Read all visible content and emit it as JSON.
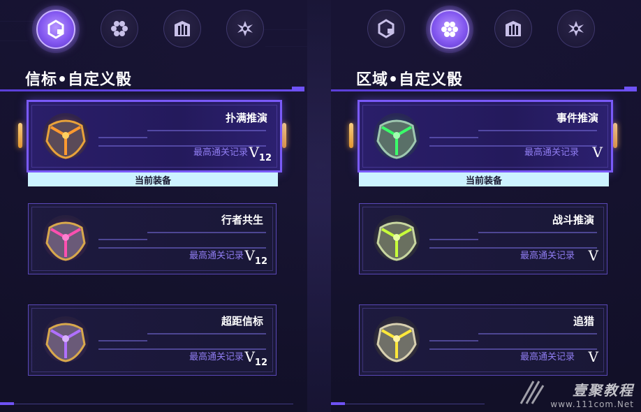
{
  "left_panel": {
    "title": "信标•自定义骰",
    "nav_icons": [
      {
        "icon": "beacon-hex-icon",
        "active": true
      },
      {
        "icon": "flower-cluster-icon",
        "active": false
      },
      {
        "icon": "pillar-block-icon",
        "active": false
      },
      {
        "icon": "starburst-icon",
        "active": false
      }
    ],
    "cards": [
      {
        "name": "扑满推演",
        "record_label": "最高通关记录",
        "grade": "V",
        "grade_sub": "12",
        "dice_color": "#e8a23a",
        "dice_glow": "#ff9a30",
        "selected": true,
        "equipped_label": "当前装备"
      },
      {
        "name": "行者共生",
        "record_label": "最高通关记录",
        "grade": "V",
        "grade_sub": "12",
        "dice_color": "#d8a84c",
        "dice_glow": "#ff4fb0",
        "selected": false
      },
      {
        "name": "超距信标",
        "record_label": "最高通关记录",
        "grade": "V",
        "grade_sub": "12",
        "dice_color": "#d8a84c",
        "dice_glow": "#b070ff",
        "selected": false
      }
    ]
  },
  "right_panel": {
    "title": "区域•自定义骰",
    "nav_icons": [
      {
        "icon": "beacon-hex-icon",
        "active": false
      },
      {
        "icon": "flower-cluster-icon",
        "active": true
      },
      {
        "icon": "pillar-block-icon",
        "active": false
      },
      {
        "icon": "starburst-icon",
        "active": false
      }
    ],
    "cards": [
      {
        "name": "事件推演",
        "record_label": "最高通关记录",
        "grade": "V",
        "grade_sub": "",
        "dice_color": "#9fc8b0",
        "dice_glow": "#3aff6a",
        "selected": true,
        "equipped_label": "当前装备"
      },
      {
        "name": "战斗推演",
        "record_label": "最高通关记录",
        "grade": "V",
        "grade_sub": "",
        "dice_color": "#c8d6a0",
        "dice_glow": "#c8ff3a",
        "selected": false
      },
      {
        "name": "追猎",
        "record_label": "最高通关记录",
        "grade": "V",
        "grade_sub": "",
        "dice_color": "#d8d0b0",
        "dice_glow": "#ffe83a",
        "selected": false
      }
    ]
  },
  "watermark": {
    "text": "壹聚教程",
    "url": "www.111com.Net"
  },
  "colors": {
    "accent": "#7a5af8",
    "equipped_bg": "#ccf2ff",
    "record_text": "#8f7cf0",
    "side_tab": "#ffc060"
  }
}
